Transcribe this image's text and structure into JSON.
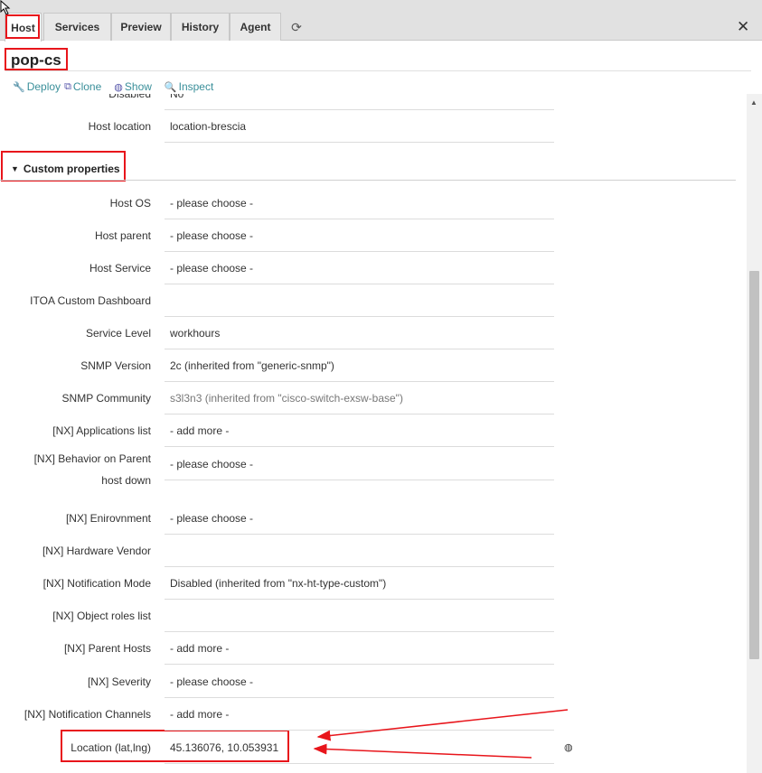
{
  "tabs": [
    {
      "label": "Host"
    },
    {
      "label": "Services"
    },
    {
      "label": "Preview"
    },
    {
      "label": "History"
    },
    {
      "label": "Agent"
    }
  ],
  "host_name": "pop-cs",
  "actions": {
    "deploy": "Deploy",
    "clone": "Clone",
    "show": "Show",
    "inspect": "Inspect"
  },
  "top_rows": {
    "disabled": {
      "label": "Disabled",
      "value": "No"
    },
    "host_location": {
      "label": "Host location",
      "value": "location-brescia"
    }
  },
  "custom_properties": {
    "title": "Custom properties",
    "fields": [
      {
        "label": "Host OS",
        "value": "- please choose -"
      },
      {
        "label": "Host parent",
        "value": "- please choose -"
      },
      {
        "label": "Host Service",
        "value": "- please choose -"
      },
      {
        "label": "ITOA Custom Dashboard",
        "value": ""
      },
      {
        "label": "Service Level",
        "value": "workhours"
      },
      {
        "label": "SNMP Version",
        "value": "2c (inherited from \"generic-snmp\")"
      },
      {
        "label": "SNMP Community",
        "value": "s3l3n3 (inherited from \"cisco-switch-exsw-base\")"
      },
      {
        "label": "[NX] Applications list",
        "value": "- add more -"
      },
      {
        "label": "[NX] Behavior on Parent host down",
        "label_line1": "[NX] Behavior on Parent",
        "label_line2": "host down",
        "value": "- please choose -"
      },
      {
        "label": "[NX] Enirovnment",
        "value": "- please choose -"
      },
      {
        "label": "[NX] Hardware Vendor",
        "value": ""
      },
      {
        "label": "[NX] Notification Mode",
        "value": "Disabled (inherited from \"nx-ht-type-custom\")"
      },
      {
        "label": "[NX] Object roles list",
        "value": ""
      },
      {
        "label": "[NX] Parent Hosts",
        "value": "- add more -"
      },
      {
        "label": "[NX] Severity",
        "value": "- please choose -"
      },
      {
        "label": "[NX] Notification Channels",
        "value": "- add more -"
      },
      {
        "label": "Location (lat,lng)",
        "value": "45.136076, 10.053931"
      }
    ]
  },
  "colors": {
    "highlight": "#e8151b",
    "action_link": "#3a8f9a"
  }
}
